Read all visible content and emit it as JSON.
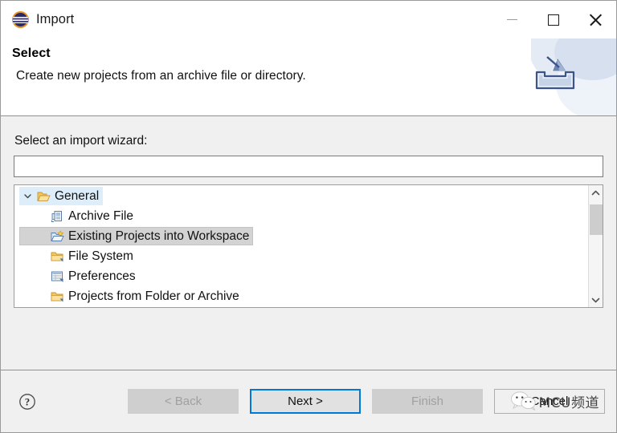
{
  "window": {
    "title": "Import",
    "logo_icon": "eclipse-logo-icon",
    "minimize_label": "Minimize",
    "maximize_label": "Maximize",
    "close_label": "Close"
  },
  "banner": {
    "heading": "Select",
    "description": "Create new projects from an archive file or directory.",
    "art_icon": "import-inbox-arrow-icon"
  },
  "form": {
    "field_label": "Select an import wizard:",
    "filter_value": "",
    "filter_placeholder": ""
  },
  "tree": {
    "rows": [
      {
        "label": "General",
        "icon": "open-folder-icon",
        "twisty": "chevron-down-icon",
        "level": 0,
        "state": "hovered"
      },
      {
        "label": "Archive File",
        "icon": "archive-file-icon",
        "level": 1,
        "state": "normal"
      },
      {
        "label": "Existing Projects into Workspace",
        "icon": "import-project-folder-icon",
        "level": 1,
        "state": "selected"
      },
      {
        "label": "File System",
        "icon": "folder-icon",
        "level": 1,
        "state": "normal"
      },
      {
        "label": "Preferences",
        "icon": "preferences-icon",
        "level": 1,
        "state": "normal"
      },
      {
        "label": "Projects from Folder or Archive",
        "icon": "folder-icon",
        "level": 1,
        "state": "normal"
      }
    ],
    "scrollbar": {
      "up_icon": "chevron-up-icon",
      "down_icon": "chevron-down-icon",
      "thumb_position": "top"
    }
  },
  "footer": {
    "help_icon": "help-question-icon",
    "buttons": [
      {
        "label": "< Back",
        "state": "disabled",
        "name": "back-button"
      },
      {
        "label": "Next >",
        "state": "default",
        "name": "next-button"
      },
      {
        "label": "Finish",
        "state": "disabled",
        "name": "finish-button"
      },
      {
        "label": "Cancel",
        "state": "enabled",
        "name": "cancel-button"
      }
    ]
  },
  "watermark": {
    "logo_icon": "wechat-logo-icon",
    "text": "MCU频道"
  },
  "colors": {
    "accent": "#0078d7",
    "dialog_bg": "#f0f0f0",
    "header_bg": "#ffffff",
    "selection": "#d3d3d3",
    "hover": "#ddeefa",
    "folder": "#e9b44c",
    "banner_art": "#dde5f2"
  }
}
